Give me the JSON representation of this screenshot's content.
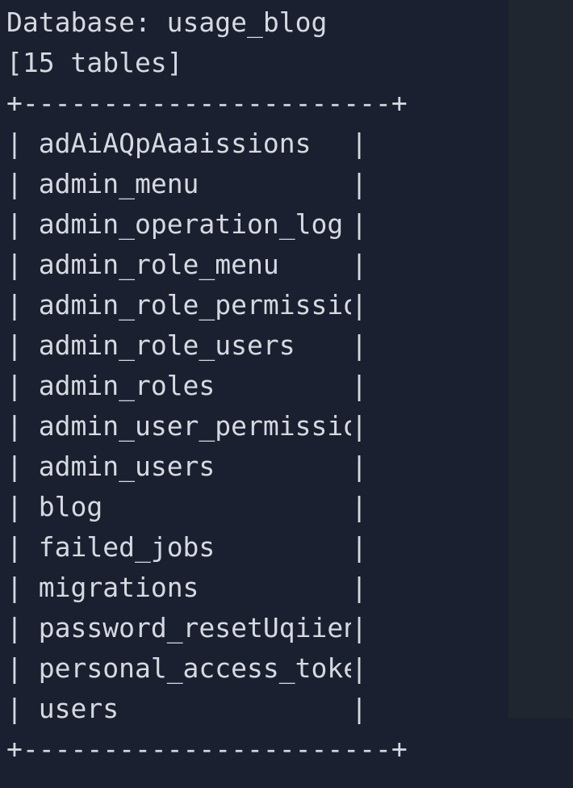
{
  "terminal": {
    "database_line": "Database: usage_blog",
    "table_count_line": "[15 tables]",
    "border_top": "+-----------------------+",
    "border_bottom": "+-----------------------+",
    "tables": [
      "adAiAQpAaaissions",
      "admin_menu",
      "admin_operation_log",
      "admin_role_menu",
      "admin_role_permissions",
      "admin_role_users",
      "admin_roles",
      "admin_user_permissions",
      "admin_users",
      "blog",
      "failed_jobs",
      "migrations",
      "password_resetUqiiena",
      "personal_access_tokens",
      "users"
    ],
    "left_pipe": "|",
    "right_pipe": "|"
  }
}
